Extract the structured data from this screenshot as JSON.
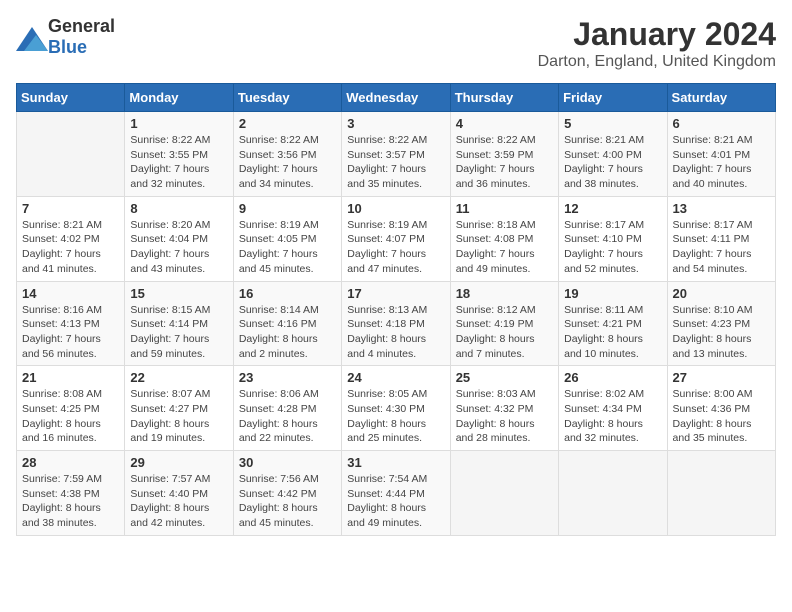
{
  "header": {
    "logo_general": "General",
    "logo_blue": "Blue",
    "month": "January 2024",
    "location": "Darton, England, United Kingdom"
  },
  "weekdays": [
    "Sunday",
    "Monday",
    "Tuesday",
    "Wednesday",
    "Thursday",
    "Friday",
    "Saturday"
  ],
  "weeks": [
    [
      {
        "day": "",
        "sunrise": "",
        "sunset": "",
        "daylight": ""
      },
      {
        "day": "1",
        "sunrise": "Sunrise: 8:22 AM",
        "sunset": "Sunset: 3:55 PM",
        "daylight": "Daylight: 7 hours and 32 minutes."
      },
      {
        "day": "2",
        "sunrise": "Sunrise: 8:22 AM",
        "sunset": "Sunset: 3:56 PM",
        "daylight": "Daylight: 7 hours and 34 minutes."
      },
      {
        "day": "3",
        "sunrise": "Sunrise: 8:22 AM",
        "sunset": "Sunset: 3:57 PM",
        "daylight": "Daylight: 7 hours and 35 minutes."
      },
      {
        "day": "4",
        "sunrise": "Sunrise: 8:22 AM",
        "sunset": "Sunset: 3:59 PM",
        "daylight": "Daylight: 7 hours and 36 minutes."
      },
      {
        "day": "5",
        "sunrise": "Sunrise: 8:21 AM",
        "sunset": "Sunset: 4:00 PM",
        "daylight": "Daylight: 7 hours and 38 minutes."
      },
      {
        "day": "6",
        "sunrise": "Sunrise: 8:21 AM",
        "sunset": "Sunset: 4:01 PM",
        "daylight": "Daylight: 7 hours and 40 minutes."
      }
    ],
    [
      {
        "day": "7",
        "sunrise": "Sunrise: 8:21 AM",
        "sunset": "Sunset: 4:02 PM",
        "daylight": "Daylight: 7 hours and 41 minutes."
      },
      {
        "day": "8",
        "sunrise": "Sunrise: 8:20 AM",
        "sunset": "Sunset: 4:04 PM",
        "daylight": "Daylight: 7 hours and 43 minutes."
      },
      {
        "day": "9",
        "sunrise": "Sunrise: 8:19 AM",
        "sunset": "Sunset: 4:05 PM",
        "daylight": "Daylight: 7 hours and 45 minutes."
      },
      {
        "day": "10",
        "sunrise": "Sunrise: 8:19 AM",
        "sunset": "Sunset: 4:07 PM",
        "daylight": "Daylight: 7 hours and 47 minutes."
      },
      {
        "day": "11",
        "sunrise": "Sunrise: 8:18 AM",
        "sunset": "Sunset: 4:08 PM",
        "daylight": "Daylight: 7 hours and 49 minutes."
      },
      {
        "day": "12",
        "sunrise": "Sunrise: 8:17 AM",
        "sunset": "Sunset: 4:10 PM",
        "daylight": "Daylight: 7 hours and 52 minutes."
      },
      {
        "day": "13",
        "sunrise": "Sunrise: 8:17 AM",
        "sunset": "Sunset: 4:11 PM",
        "daylight": "Daylight: 7 hours and 54 minutes."
      }
    ],
    [
      {
        "day": "14",
        "sunrise": "Sunrise: 8:16 AM",
        "sunset": "Sunset: 4:13 PM",
        "daylight": "Daylight: 7 hours and 56 minutes."
      },
      {
        "day": "15",
        "sunrise": "Sunrise: 8:15 AM",
        "sunset": "Sunset: 4:14 PM",
        "daylight": "Daylight: 7 hours and 59 minutes."
      },
      {
        "day": "16",
        "sunrise": "Sunrise: 8:14 AM",
        "sunset": "Sunset: 4:16 PM",
        "daylight": "Daylight: 8 hours and 2 minutes."
      },
      {
        "day": "17",
        "sunrise": "Sunrise: 8:13 AM",
        "sunset": "Sunset: 4:18 PM",
        "daylight": "Daylight: 8 hours and 4 minutes."
      },
      {
        "day": "18",
        "sunrise": "Sunrise: 8:12 AM",
        "sunset": "Sunset: 4:19 PM",
        "daylight": "Daylight: 8 hours and 7 minutes."
      },
      {
        "day": "19",
        "sunrise": "Sunrise: 8:11 AM",
        "sunset": "Sunset: 4:21 PM",
        "daylight": "Daylight: 8 hours and 10 minutes."
      },
      {
        "day": "20",
        "sunrise": "Sunrise: 8:10 AM",
        "sunset": "Sunset: 4:23 PM",
        "daylight": "Daylight: 8 hours and 13 minutes."
      }
    ],
    [
      {
        "day": "21",
        "sunrise": "Sunrise: 8:08 AM",
        "sunset": "Sunset: 4:25 PM",
        "daylight": "Daylight: 8 hours and 16 minutes."
      },
      {
        "day": "22",
        "sunrise": "Sunrise: 8:07 AM",
        "sunset": "Sunset: 4:27 PM",
        "daylight": "Daylight: 8 hours and 19 minutes."
      },
      {
        "day": "23",
        "sunrise": "Sunrise: 8:06 AM",
        "sunset": "Sunset: 4:28 PM",
        "daylight": "Daylight: 8 hours and 22 minutes."
      },
      {
        "day": "24",
        "sunrise": "Sunrise: 8:05 AM",
        "sunset": "Sunset: 4:30 PM",
        "daylight": "Daylight: 8 hours and 25 minutes."
      },
      {
        "day": "25",
        "sunrise": "Sunrise: 8:03 AM",
        "sunset": "Sunset: 4:32 PM",
        "daylight": "Daylight: 8 hours and 28 minutes."
      },
      {
        "day": "26",
        "sunrise": "Sunrise: 8:02 AM",
        "sunset": "Sunset: 4:34 PM",
        "daylight": "Daylight: 8 hours and 32 minutes."
      },
      {
        "day": "27",
        "sunrise": "Sunrise: 8:00 AM",
        "sunset": "Sunset: 4:36 PM",
        "daylight": "Daylight: 8 hours and 35 minutes."
      }
    ],
    [
      {
        "day": "28",
        "sunrise": "Sunrise: 7:59 AM",
        "sunset": "Sunset: 4:38 PM",
        "daylight": "Daylight: 8 hours and 38 minutes."
      },
      {
        "day": "29",
        "sunrise": "Sunrise: 7:57 AM",
        "sunset": "Sunset: 4:40 PM",
        "daylight": "Daylight: 8 hours and 42 minutes."
      },
      {
        "day": "30",
        "sunrise": "Sunrise: 7:56 AM",
        "sunset": "Sunset: 4:42 PM",
        "daylight": "Daylight: 8 hours and 45 minutes."
      },
      {
        "day": "31",
        "sunrise": "Sunrise: 7:54 AM",
        "sunset": "Sunset: 4:44 PM",
        "daylight": "Daylight: 8 hours and 49 minutes."
      },
      {
        "day": "",
        "sunrise": "",
        "sunset": "",
        "daylight": ""
      },
      {
        "day": "",
        "sunrise": "",
        "sunset": "",
        "daylight": ""
      },
      {
        "day": "",
        "sunrise": "",
        "sunset": "",
        "daylight": ""
      }
    ]
  ]
}
